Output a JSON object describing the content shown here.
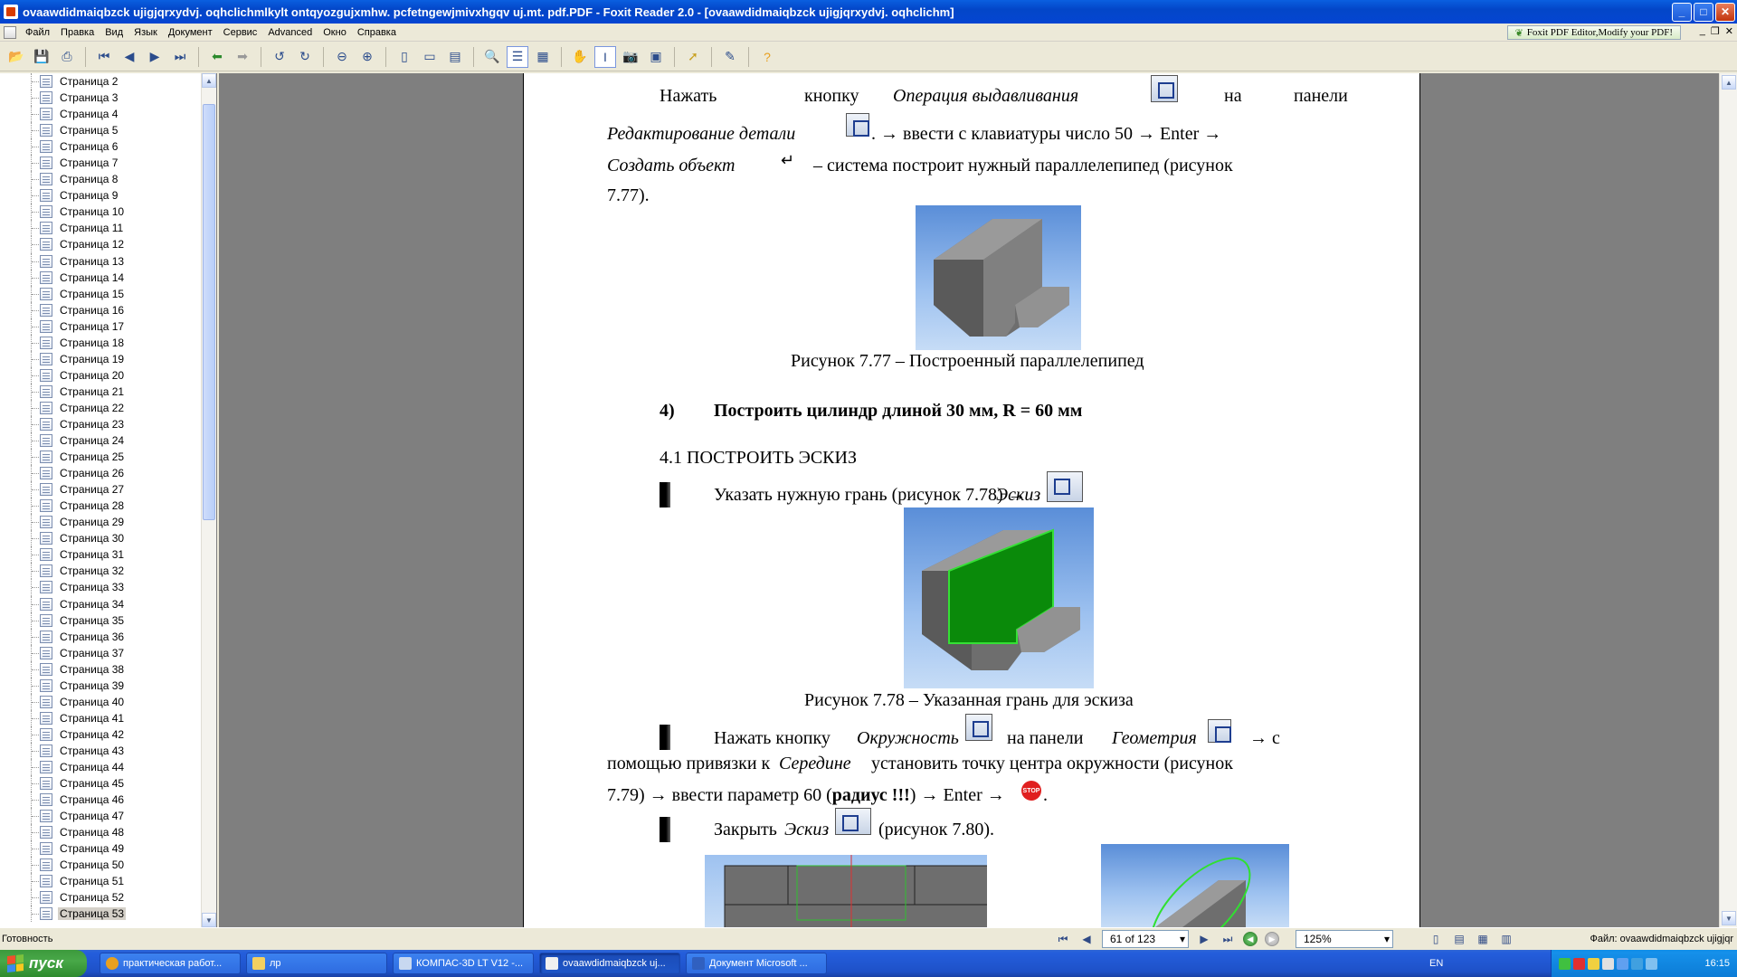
{
  "window": {
    "title": "ovaawdidmaiqbzck ujigjqrxydvj. oqhclichmlkylt ontqyozgujxmhw. pcfetngewjmivxhgqv uj.mt. pdf.PDF - Foxit Reader 2.0 - [ovaawdidmaiqbzck ujigjqrxydvj. oqhclichm]",
    "minimize": "_",
    "maximize": "□",
    "close": "✕"
  },
  "menu": {
    "items": [
      "Файл",
      "Правка",
      "Вид",
      "Язык",
      "Документ",
      "Сервис",
      "Advanced",
      "Окно",
      "Справка"
    ],
    "banner": "Foxit PDF Editor,Modify your PDF!",
    "mdi": [
      "_",
      "❐",
      "✕"
    ]
  },
  "sidebar": {
    "pages": [
      "Страница 2",
      "Страница 3",
      "Страница 4",
      "Страница 5",
      "Страница 6",
      "Страница 7",
      "Страница 8",
      "Страница 9",
      "Страница 10",
      "Страница 11",
      "Страница 12",
      "Страница 13",
      "Страница 14",
      "Страница 15",
      "Страница 16",
      "Страница 17",
      "Страница 18",
      "Страница 19",
      "Страница 20",
      "Страница 21",
      "Страница 22",
      "Страница 23",
      "Страница 24",
      "Страница 25",
      "Страница 26",
      "Страница 27",
      "Страница 28",
      "Страница 29",
      "Страница 30",
      "Страница 31",
      "Страница 32",
      "Страница 33",
      "Страница 34",
      "Страница 35",
      "Страница 36",
      "Страница 37",
      "Страница 38",
      "Страница 39",
      "Страница 40",
      "Страница 41",
      "Страница 42",
      "Страница 43",
      "Страница 44",
      "Страница 45",
      "Страница 46",
      "Страница 47",
      "Страница 48",
      "Страница 49",
      "Страница 50",
      "Страница 51",
      "Страница 52",
      "Страница 53"
    ],
    "selected": "Страница 53"
  },
  "document": {
    "p1_a": "Нажать",
    "p1_b": "кнопку",
    "p1_c": "Операция выдавливания",
    "p1_d": "на",
    "p1_e": "панели",
    "p2_a": "Редактирование детали",
    "p2_b": ". → ввести с клавиатуры число 50 →  Enter →",
    "p3_a": "Создать объект",
    "p3_b": "– система построит нужный параллелепипед (рисунок",
    "p4": "7.77).",
    "fig1_caption": "Рисунок 7.77 – Построенный параллелепипед",
    "section4_num": "4)",
    "section4_title": "Построить цилиндр длиной 30 мм, R =  60 мм",
    "section41": "4.1  ПОСТРОИТЬ ЭСКИЗ",
    "step1_a": "Указать нужную грань  (рисунок 7.78) →",
    "step1_b": "Эскиз",
    "fig2_caption": "Рисунок 7.78 – Указанная грань для эскиза",
    "step2_a": "Нажать  кнопку",
    "step2_b": "Окружность",
    "step2_c": "на  панели",
    "step2_d": "Геометрия",
    "step2_e": "→  с",
    "step2_line2_a": "помощью привязки к",
    "step2_line2_b": "Середине",
    "step2_line2_c": "установить точку центра окружности (рисунок",
    "step2_line3_a": "7.79) → ввести параметр 60 (",
    "step2_line3_b": "радиус !!!",
    "step2_line3_c": ")  → Enter →",
    "step2_line3_d": ".",
    "step3_a": "Закрыть",
    "step3_b": "Эскиз",
    "step3_c": "(рисунок 7.80)."
  },
  "status": {
    "text": "Готовность",
    "page_display": "61 of 123",
    "zoom": "125%",
    "file": "Файл: ovaawdidmaiqbzck ujigjqr"
  },
  "taskbar": {
    "start": "пуск",
    "tasks": [
      {
        "label": "практическая работ...",
        "icon_color": "#E8A020"
      },
      {
        "label": "лр",
        "icon_color": "#F4D060"
      },
      {
        "label": "КОМПАС-3D LT V12 -...",
        "icon_color": "#C8D8F0"
      },
      {
        "label": "ovaawdidmaiqbzck uj...",
        "icon_color": "#F0F0F0",
        "active": true
      },
      {
        "label": "Документ Microsoft ...",
        "icon_color": "#3060C0"
      }
    ],
    "lang": "EN",
    "clock": "16:15"
  }
}
